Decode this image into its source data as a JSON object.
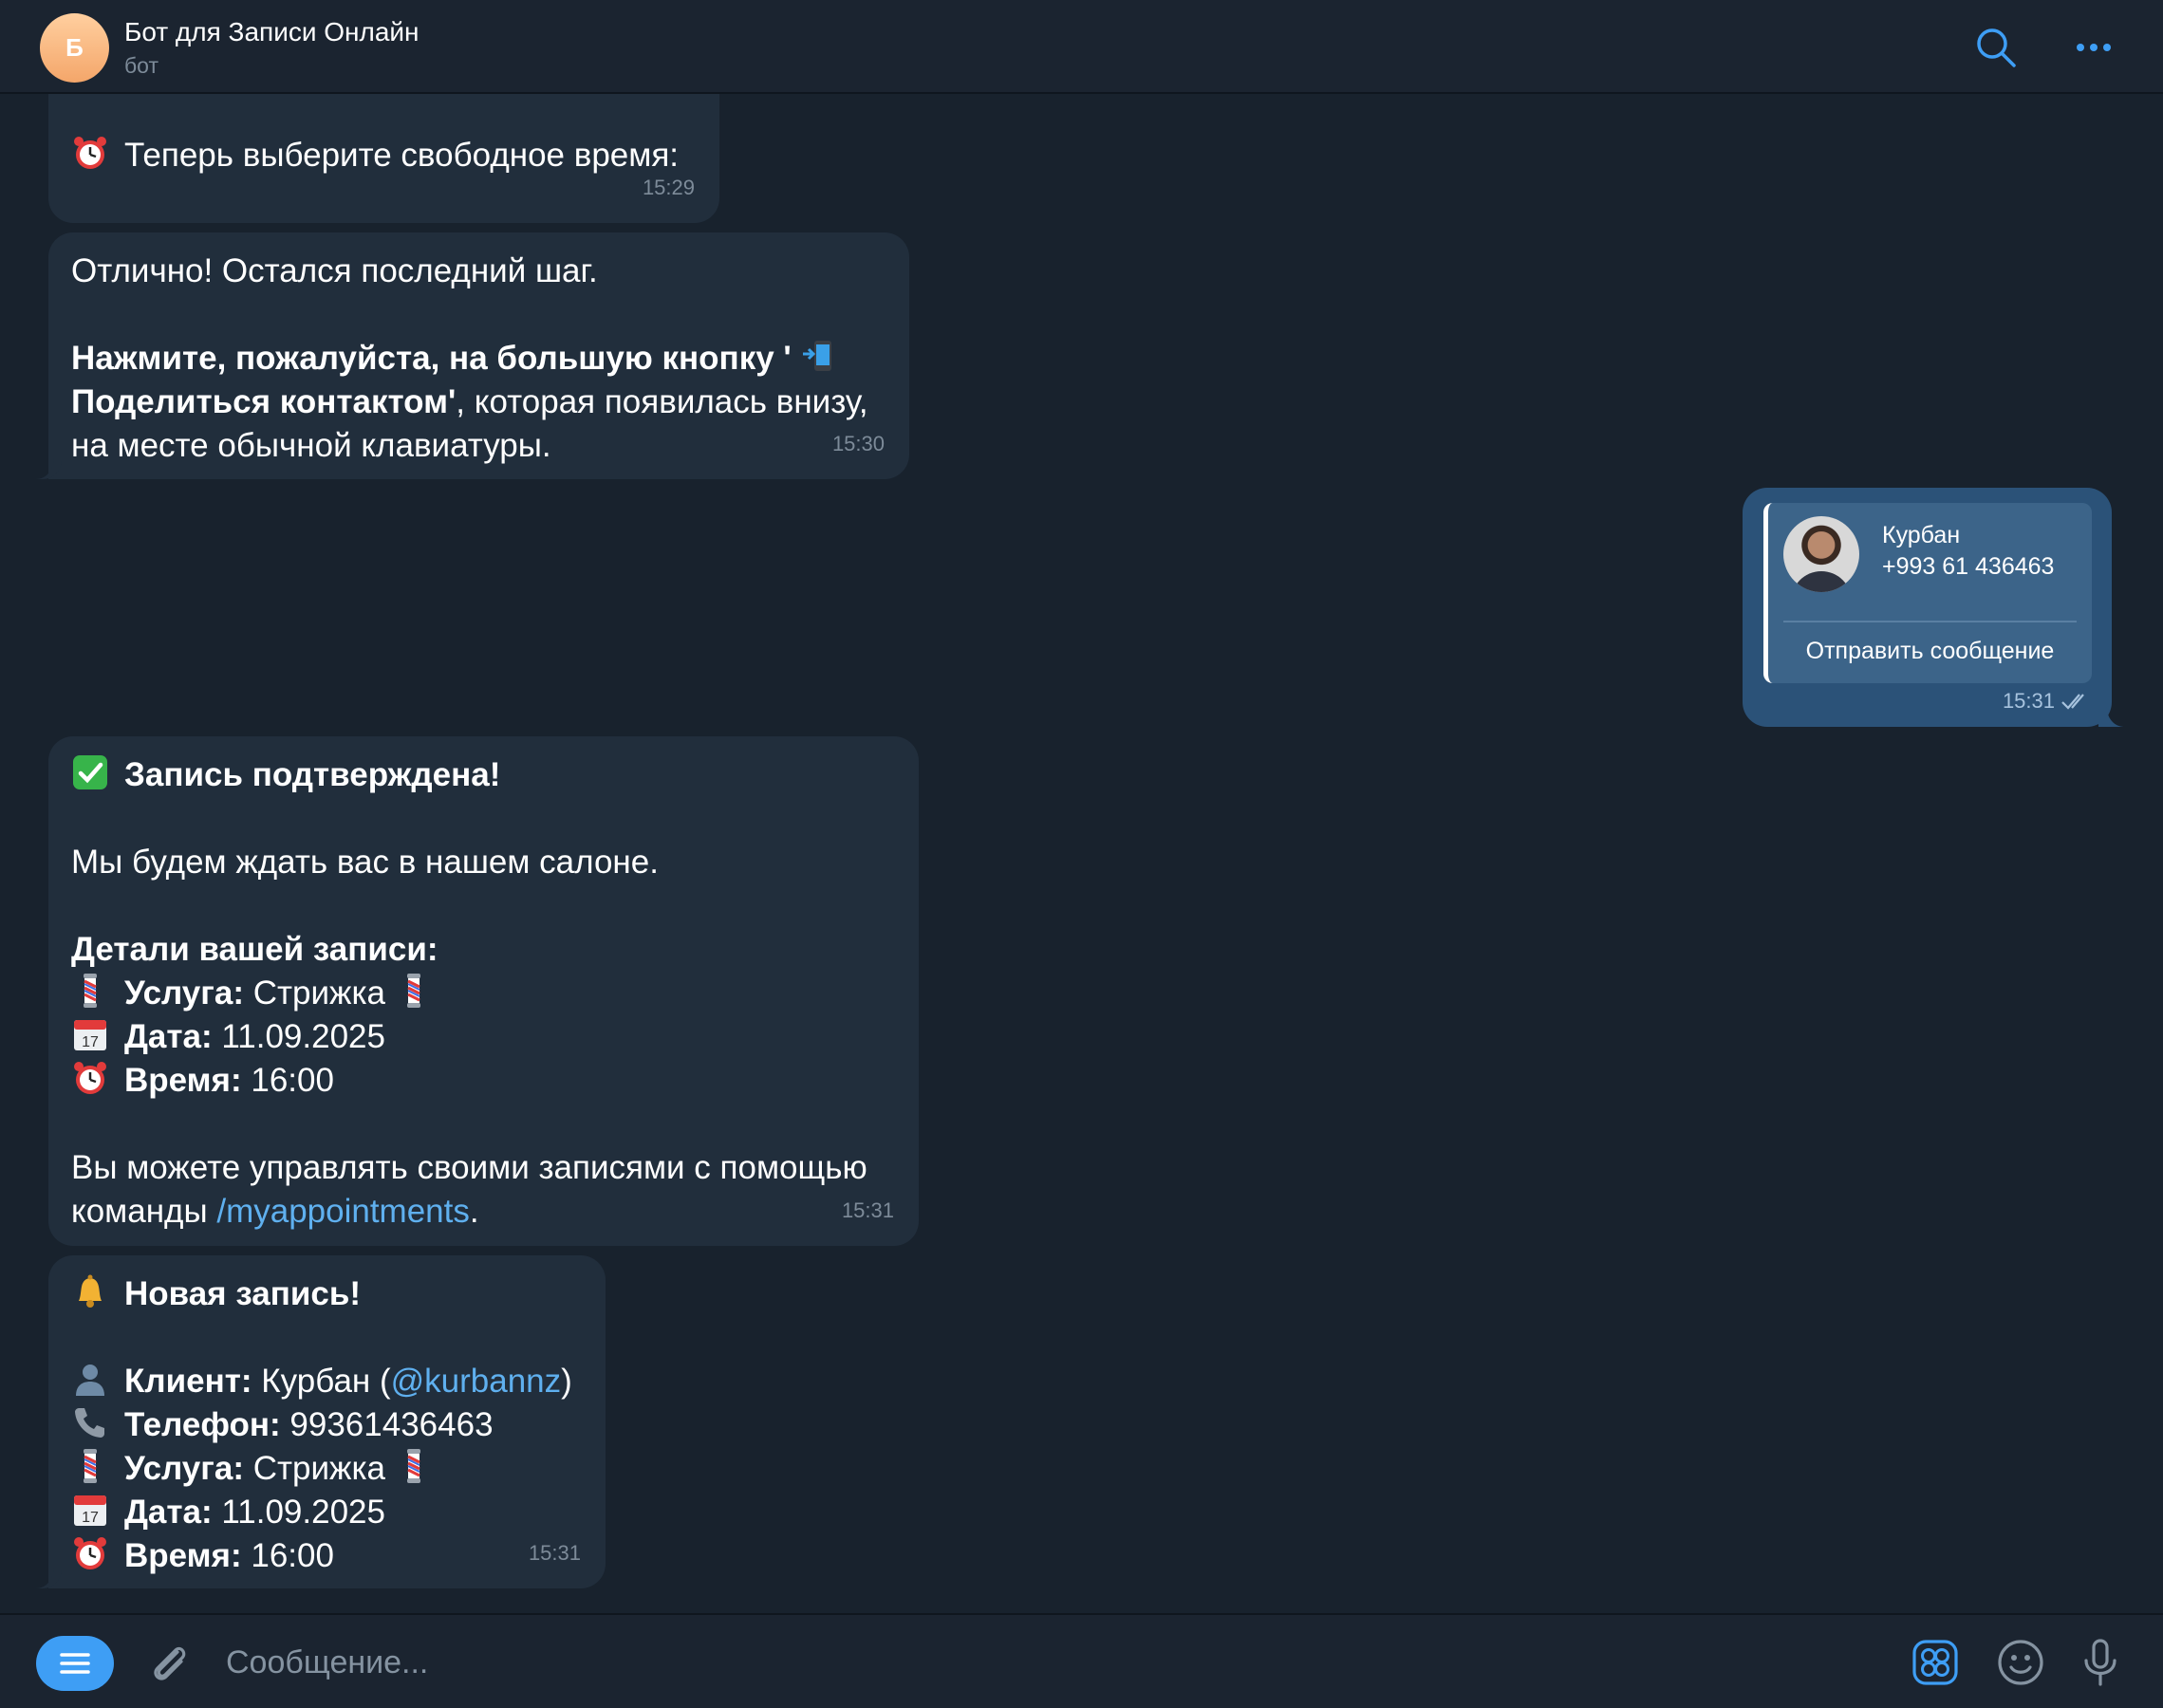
{
  "header": {
    "avatar_letter": "Б",
    "title": "Бот для Записи Онлайн",
    "subtitle": "бот",
    "icons": [
      "search-icon",
      "more-icon"
    ]
  },
  "messages": {
    "m1": {
      "text": "Теперь выберите свободное время:",
      "time": "15:29"
    },
    "m2": {
      "line1": "Отлично! Остался последний шаг.",
      "line2_bold": "Нажмите, пожалуйста, на большую кнопку '",
      "line3_bold": "Поделиться контактом'",
      "line3_rest": ", которая появилась внизу,",
      "line4": "на месте обычной клавиатуры.",
      "time": "15:30"
    },
    "contact": {
      "name": "Курбан",
      "phone": "+993 61 436463",
      "action": "Отправить сообщение",
      "time": "15:31"
    },
    "m3": {
      "heading": "Запись подтверждена!",
      "line1": "Мы будем ждать вас в нашем салоне.",
      "details_heading": "Детали вашей записи:",
      "service_label": "Услуга:",
      "service_value": " Стрижка",
      "date_label": "Дата:",
      "date_value": " 11.09.2025",
      "time_label": "Время:",
      "time_value": " 16:00",
      "manage_line1": "Вы можете управлять своими записями с помощью",
      "manage_prefix": "команды ",
      "command": "/myappointments",
      "manage_suffix": ".",
      "time": "15:31"
    },
    "m4": {
      "heading": "Новая запись!",
      "client_label": "Клиент:",
      "client_value": " Курбан (",
      "client_username": "@kurbannz",
      "client_close": ")",
      "phone_label": "Телефон:",
      "phone_value": " 99361436463",
      "service_label": "Услуга:",
      "service_value": " Стрижка",
      "date_label": "Дата:",
      "date_value": " 11.09.2025",
      "time_label": "Время:",
      "time_value": " 16:00",
      "time": "15:31"
    }
  },
  "composer": {
    "placeholder": "Сообщение...",
    "icons": [
      "menu-icon",
      "paperclip-icon",
      "sticker-icon",
      "emoji-icon",
      "microphone-icon"
    ]
  },
  "colors": {
    "background": "#18222d",
    "bubble_in": "#212e3c",
    "bubble_out": "#2b5278",
    "accent": "#3e9ef5",
    "link": "#5fb0ef"
  }
}
